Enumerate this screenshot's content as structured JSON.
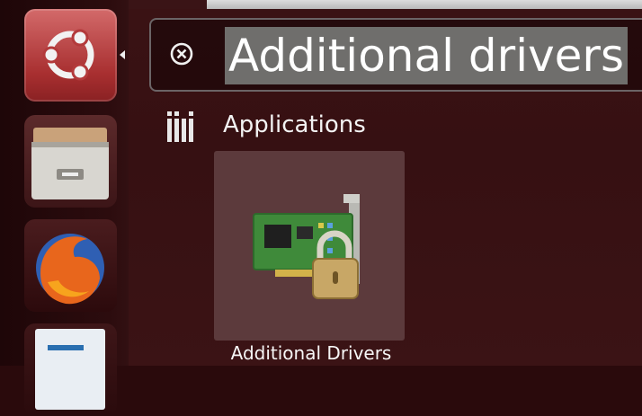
{
  "search": {
    "query": "Additional drivers"
  },
  "results": {
    "section_label": "Applications",
    "items": [
      {
        "label": "Additional Drivers",
        "icon": "hardware-drivers-icon"
      }
    ]
  },
  "launcher": {
    "items": [
      "ubuntu-dash-icon",
      "files-icon",
      "firefox-icon",
      "libreoffice-writer-icon"
    ]
  },
  "colors": {
    "background": "#2a0a0c",
    "dash_active": "#a82f30",
    "search_highlight": "#6f6e6c",
    "result_highlight": "#5c3a3c"
  }
}
